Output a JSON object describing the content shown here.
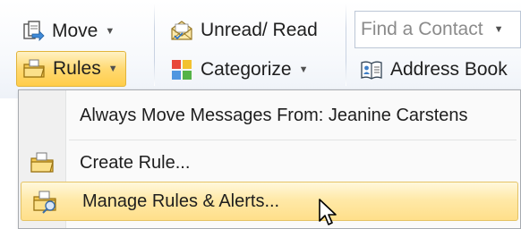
{
  "ribbon": {
    "move_label": "Move",
    "rules_label": "Rules",
    "unread_read_label": "Unread/ Read",
    "categorize_label": "Categorize",
    "find_contact_placeholder": "Find a Contact",
    "address_book_label": "Address Book"
  },
  "rules_menu": {
    "items": [
      {
        "label": "Always Move Messages From: Jeanine Carstens"
      },
      {
        "label": "Create Rule..."
      },
      {
        "label": "Manage Rules & Alerts..."
      }
    ]
  },
  "colors": {
    "active_button_fill": "#ffd971",
    "active_button_border": "#e2b43a",
    "menu_hover_fill": "#ffe9a8"
  },
  "icons": [
    "move-icon",
    "rules-icon",
    "unread-read-icon",
    "categorize-icon",
    "address-book-icon",
    "create-rule-icon",
    "manage-rules-icon"
  ]
}
